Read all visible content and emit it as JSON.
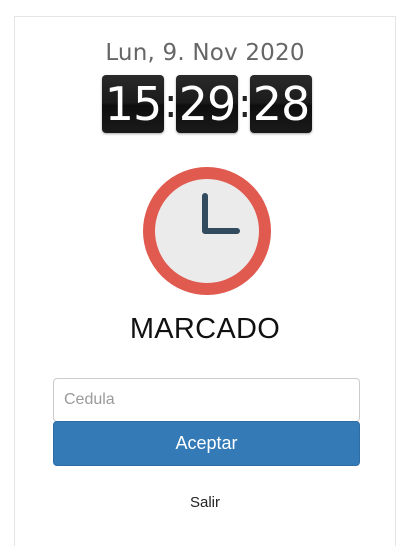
{
  "header": {
    "date": "Lun, 9. Nov 2020"
  },
  "clock": {
    "hours": "15",
    "minutes": "29",
    "seconds": "28",
    "separator": ":"
  },
  "icon": {
    "name": "clock-icon",
    "ring_color": "#e05a4f",
    "face_color": "#ebebeb",
    "hands_color": "#324a5e"
  },
  "status": {
    "label": "MARCADO"
  },
  "form": {
    "cedula_placeholder": "Cedula",
    "cedula_value": "",
    "accept_label": "Aceptar",
    "accent": "#337ab7"
  },
  "footer": {
    "logout_label": "Salir"
  }
}
